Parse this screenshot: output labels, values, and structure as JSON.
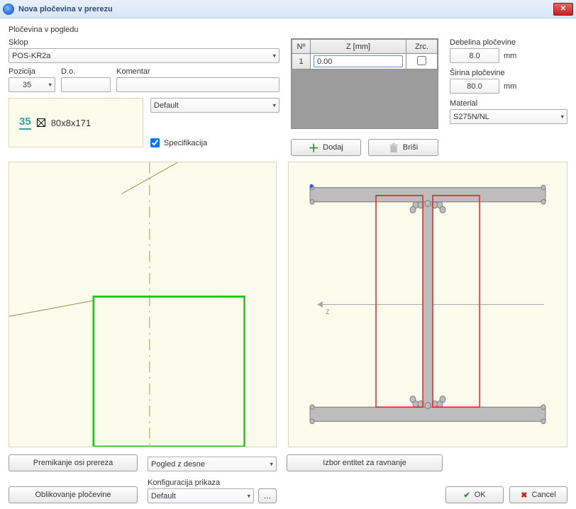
{
  "window": {
    "title": "Nova pločevina v prerezu"
  },
  "header": {
    "section": "Pločevina v pogledu"
  },
  "left": {
    "sklop_label": "Sklop",
    "sklop_value": "POS-KR2a",
    "pozicija_label": "Pozicija",
    "pozicija_value": "35",
    "do_label": "D.o.",
    "do_value": "",
    "komentar_label": "Komentar",
    "komentar_value": "",
    "default_combo": "Default",
    "info_num": "35",
    "info_dims": "80x8x171",
    "spec_label": "Specifikacija",
    "spec_checked": true
  },
  "mid": {
    "table": {
      "headers": {
        "no": "Nº",
        "z": "Z [mm]",
        "zrc": "Zrc."
      },
      "rows": [
        {
          "no": "1",
          "z": "0.00",
          "zrc": false
        }
      ]
    },
    "dodaj_label": "Dodaj",
    "brisi_label": "Briši"
  },
  "right": {
    "deb_label": "Debelina pločevine",
    "deb_value": "8.0",
    "deb_unit": "mm",
    "sir_label": "Širina pločevine",
    "sir_value": "80.0",
    "sir_unit": "mm",
    "mat_label": "Material",
    "mat_value": "S275N/NL"
  },
  "footer": {
    "premikanje": "Premikanje osi prereza",
    "pogled_value": "Pogled z desne",
    "izbor": "Izbor entitet za ravnanje",
    "oblikovanje": "Oblikovanje pločevine",
    "konfig_label": "Konfiguracija prikaza",
    "konfig_value": "Default",
    "ok": "OK",
    "cancel": "Cancel"
  },
  "chart_data": {
    "type": "diagram",
    "left_preview": "Green rectangle (plate outline) with vertical dash-dot centerline and an oblique guideline",
    "right_preview": "I-beam cross-section in grey with two red vertical stiffener plate outlines flanking the web; horizontal axis arrow labeled z"
  }
}
